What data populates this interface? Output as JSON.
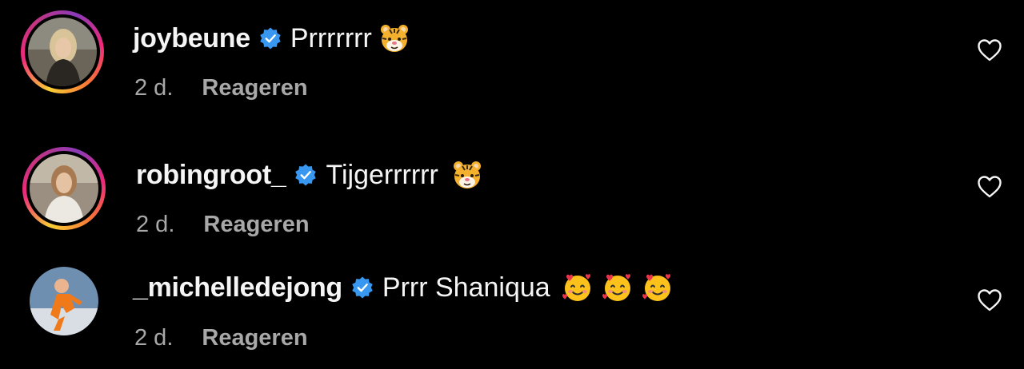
{
  "comments": [
    {
      "username": "joybeune",
      "text": "Prrrrrrr",
      "time": "2 d.",
      "reply_label": "Reageren",
      "emojis": [
        "tiger-face-emoji"
      ],
      "has_story_ring": true
    },
    {
      "username": "robingroot_",
      "text": "Tijgerrrrrr",
      "time": "2 d.",
      "reply_label": "Reageren",
      "emojis": [
        "tiger-face-emoji"
      ],
      "has_story_ring": true
    },
    {
      "username": "_michelledejong",
      "text": "Prrr Shaniqua",
      "time": "2 d.",
      "reply_label": "Reageren",
      "emojis": [
        "smiling-face-with-hearts-emoji",
        "smiling-face-with-hearts-emoji",
        "smiling-face-with-hearts-emoji"
      ],
      "has_story_ring": false
    }
  ],
  "icons": {
    "verified": "verified-badge-icon",
    "like": "heart-outline-icon"
  },
  "colors": {
    "background": "#000000",
    "primary_text": "#f5f5f5",
    "secondary_text": "#a8a8a8",
    "verified_blue": "#3897f0"
  }
}
